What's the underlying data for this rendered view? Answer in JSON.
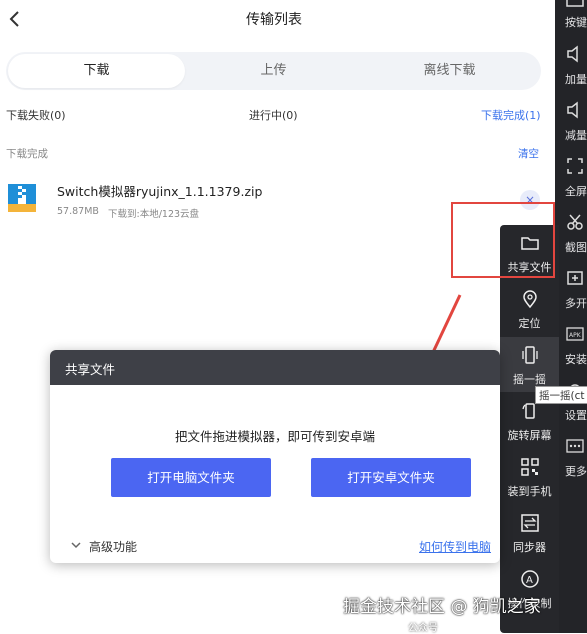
{
  "header": {
    "title": "传输列表",
    "back_icon": "chevron-left-icon"
  },
  "tabs": [
    {
      "label": "下载",
      "active": true
    },
    {
      "label": "上传",
      "active": false
    },
    {
      "label": "离线下载",
      "active": false
    }
  ],
  "summary": {
    "failed": "下载失败(0)",
    "in_progress": "进行中(0)",
    "completed": "下载完成(1)"
  },
  "section": {
    "label": "下载完成",
    "clear": "清空"
  },
  "file": {
    "name": "Switch模拟器ryujinx_1.1.1379.zip",
    "size": "57.87MB",
    "dest": "下载到:本地/123云盘",
    "icon": "zip-file-icon",
    "remove": "×"
  },
  "toolbar": {
    "items": [
      {
        "label": "按键",
        "icon": "keyboard-icon"
      },
      {
        "label": "加量",
        "icon": "volume-up-icon"
      },
      {
        "label": "减量",
        "icon": "volume-down-icon"
      },
      {
        "label": "全屏",
        "icon": "fullscreen-icon"
      },
      {
        "label": "截图",
        "icon": "scissors-icon"
      },
      {
        "label": "多开",
        "icon": "multi-instance-icon"
      },
      {
        "label": "安装",
        "icon": "apk-icon"
      },
      {
        "label": "设置",
        "icon": "gear-icon"
      },
      {
        "label": "更多",
        "icon": "more-icon"
      }
    ]
  },
  "float_menu": {
    "items": [
      {
        "label": "共享文件",
        "icon": "folder-icon"
      },
      {
        "label": "定位",
        "icon": "location-pin-icon"
      },
      {
        "label": "摇一摇",
        "icon": "shake-icon"
      },
      {
        "label": "旋转屏幕",
        "icon": "rotate-screen-icon"
      },
      {
        "label": "装到手机",
        "icon": "qr-code-icon"
      },
      {
        "label": "同步器",
        "icon": "sync-icon"
      },
      {
        "label": "操作录制",
        "icon": "record-icon"
      }
    ],
    "tooltip": "摇一摇(ct"
  },
  "dialog": {
    "title": "共享文件",
    "message": "把文件拖进模拟器，即可传到安卓端",
    "btn_pc": "打开电脑文件夹",
    "btn_android": "打开安卓文件夹",
    "advanced": "高级功能",
    "help": "如何传到电脑"
  },
  "watermark": {
    "text": "掘金技术社区 @ 狗凯之家",
    "sub": "公众号"
  },
  "colors": {
    "accent": "#3a72ec",
    "button": "#4b66f2",
    "highlight": "#e2463f",
    "toolbar_bg": "#232428"
  }
}
